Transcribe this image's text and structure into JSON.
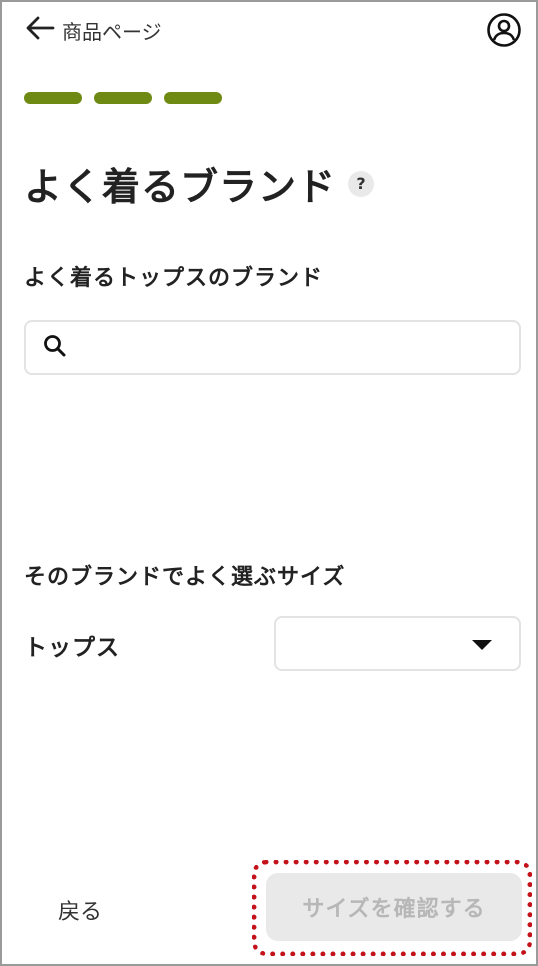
{
  "header": {
    "back_label": "商品ページ",
    "back_icon": "arrow-left-icon",
    "account_icon": "user-circle-icon"
  },
  "progress": {
    "steps_total": 3,
    "steps_completed": 3,
    "accent_color": "#6f8a13"
  },
  "page": {
    "title": "よく着るブランド",
    "help_label": "?"
  },
  "brand_section": {
    "label": "よく着るトップスのブランド",
    "search_value": "",
    "search_placeholder": "",
    "search_icon": "search-icon"
  },
  "size_section": {
    "label": "そのブランドでよく選ぶサイズ",
    "tops_label": "トップス",
    "tops_selected": "",
    "dropdown_icon": "caret-down-icon"
  },
  "footer": {
    "back_label": "戻る",
    "confirm_label": "サイズを確認する",
    "confirm_enabled": false,
    "highlight_color": "#c4121a"
  }
}
